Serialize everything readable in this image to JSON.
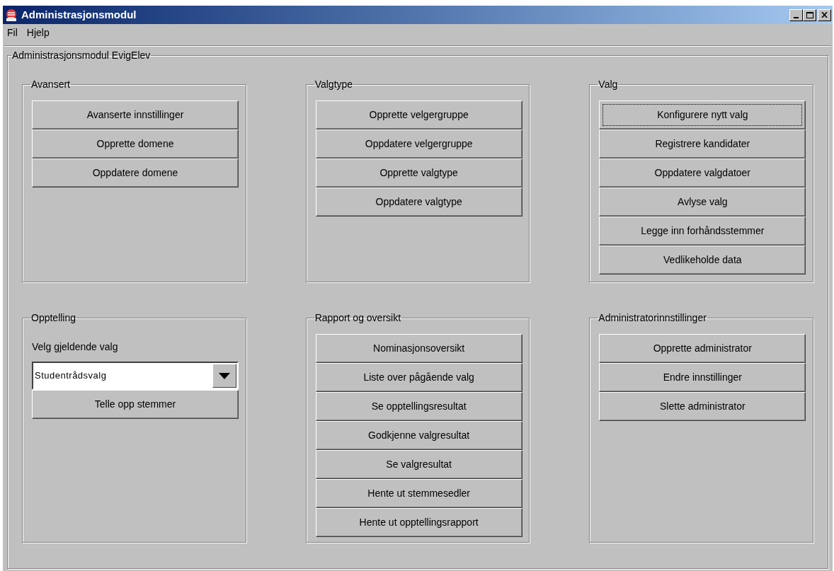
{
  "window": {
    "title": "Administrasjonsmodul"
  },
  "menu": [
    {
      "label": "Fil"
    },
    {
      "label": "Hjelp"
    }
  ],
  "main_group": {
    "title": "Administrasjonsmodul EvigElev",
    "panels": [
      {
        "kind": "buttons",
        "title": "Avansert",
        "buttons": [
          {
            "label": "Avanserte innstillinger",
            "focused": false
          },
          {
            "label": "Opprette domene",
            "focused": false
          },
          {
            "label": "Oppdatere domene",
            "focused": false
          }
        ]
      },
      {
        "kind": "buttons",
        "title": "Valgtype",
        "buttons": [
          {
            "label": "Opprette velgergruppe",
            "focused": false
          },
          {
            "label": "Oppdatere velgergruppe",
            "focused": false
          },
          {
            "label": "Opprette valgtype",
            "focused": false
          },
          {
            "label": "Oppdatere valgtype",
            "focused": false
          }
        ]
      },
      {
        "kind": "buttons",
        "title": "Valg",
        "buttons": [
          {
            "label": "Konfigurere nytt valg",
            "focused": true
          },
          {
            "label": "Registrere kandidater",
            "focused": false
          },
          {
            "label": "Oppdatere valgdatoer",
            "focused": false
          },
          {
            "label": "Avlyse valg",
            "focused": false
          },
          {
            "label": "Legge inn forhåndsstemmer",
            "focused": false
          },
          {
            "label": "Vedlikeholde data",
            "focused": false
          }
        ]
      },
      {
        "kind": "selection",
        "title": "Opptelling",
        "label": "Velg gjeldende valg",
        "select": {
          "value": "Studentrådsvalg"
        },
        "buttons": [
          {
            "label": "Telle opp stemmer",
            "focused": false
          }
        ]
      },
      {
        "kind": "buttons",
        "title": "Rapport og oversikt",
        "buttons": [
          {
            "label": "Nominasjonsoversikt",
            "focused": false
          },
          {
            "label": "Liste over pågående valg",
            "focused": false
          },
          {
            "label": "Se opptellingsresultat",
            "focused": false
          },
          {
            "label": "Godkjenne valgresultat",
            "focused": false
          },
          {
            "label": "Se valgresultat",
            "focused": false
          },
          {
            "label": "Hente ut stemmesedler",
            "focused": false
          },
          {
            "label": "Hente ut opptellingsrapport",
            "focused": false
          }
        ]
      },
      {
        "kind": "buttons",
        "title": "Administratorinnstillinger",
        "buttons": [
          {
            "label": "Opprette administrator",
            "focused": false
          },
          {
            "label": "Endre innstillinger",
            "focused": false
          },
          {
            "label": "Slette administrator",
            "focused": false
          }
        ]
      }
    ]
  }
}
